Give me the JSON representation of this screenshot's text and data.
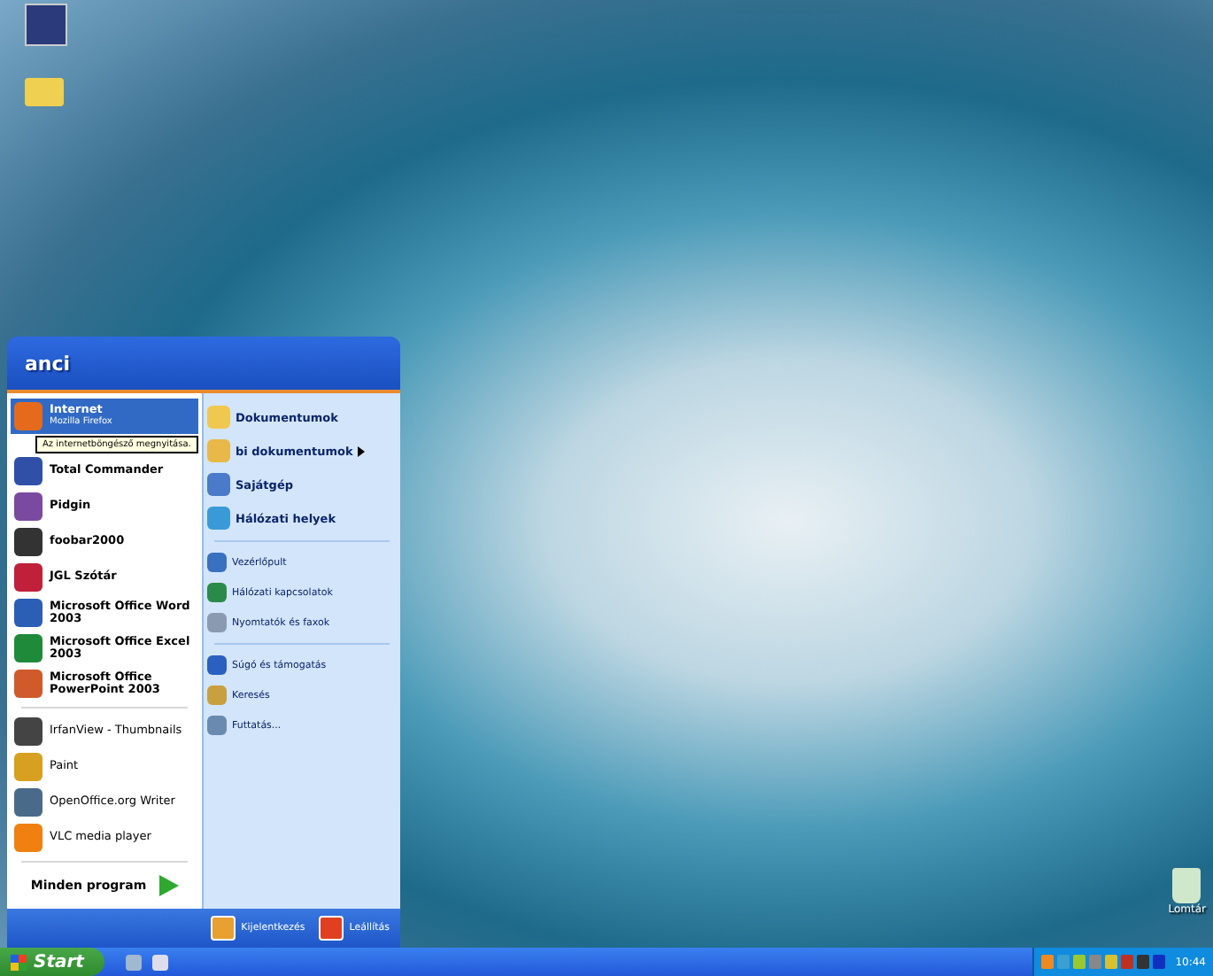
{
  "desktop": {
    "icons": [
      {
        "kind": "app"
      },
      {
        "kind": "folder"
      },
      {
        "kind": "recycle",
        "label": "Lomtár"
      }
    ]
  },
  "start_menu": {
    "user": "anci",
    "top_programs": [
      {
        "title": "Internet",
        "subtitle": "Mozilla Firefox",
        "selected": true
      },
      {
        "title": "Total Commander",
        "selected": false
      },
      {
        "title": "Pidgin",
        "selected": false
      },
      {
        "title": "foobar2000",
        "selected": false
      },
      {
        "title": "JGL Szótár",
        "selected": false
      },
      {
        "title": "Microsoft Office Word 2003",
        "selected": false
      },
      {
        "title": "Microsoft Office Excel 2003",
        "selected": false
      },
      {
        "title": "Microsoft Office PowerPoint 2003",
        "selected": false
      }
    ],
    "recent_programs": [
      {
        "title": "IrfanView - Thumbnails",
        "selected": false
      },
      {
        "title": "Paint",
        "selected": false
      },
      {
        "title": "OpenOffice.org Writer",
        "selected": false
      },
      {
        "title": "VLC media player",
        "selected": false
      }
    ],
    "all_programs": "Minden program",
    "tooltip": "Az internetböngésző megnyitása.",
    "places": [
      [
        {
          "label": "Dokumentumok",
          "submenu": false
        },
        {
          "label": "bi dokumentumok",
          "submenu": true
        },
        {
          "label": "Sajátgép",
          "submenu": false
        },
        {
          "label": "Hálózati helyek",
          "submenu": false
        }
      ],
      [
        {
          "label": "Vezérlőpult",
          "submenu": false
        },
        {
          "label": "Hálózati kapcsolatok",
          "submenu": false
        },
        {
          "label": "Nyomtatók és faxok",
          "submenu": false
        }
      ],
      [
        {
          "label": "Súgó és támogatás",
          "submenu": false
        },
        {
          "label": "Keresés",
          "submenu": false
        },
        {
          "label": "Futtatás...",
          "submenu": false
        }
      ]
    ],
    "logoff": "Kijelentkezés",
    "shutdown": "Leállítás"
  },
  "taskbar": {
    "start": "Start",
    "clock": "10:44"
  }
}
